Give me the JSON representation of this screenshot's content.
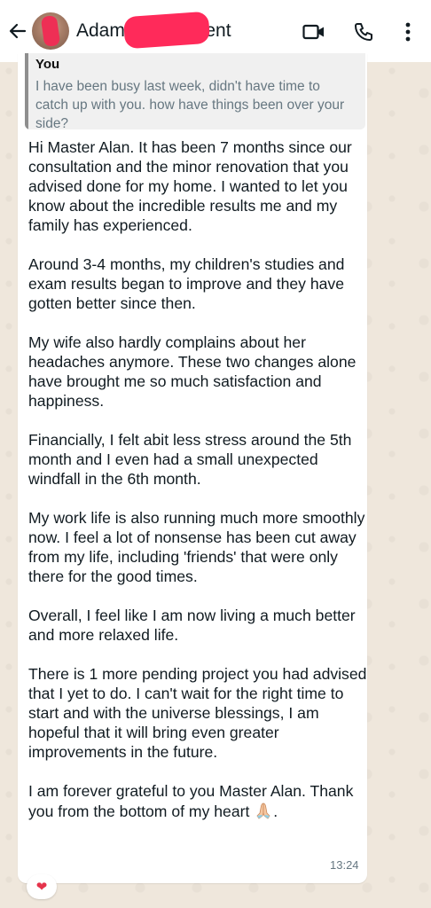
{
  "header": {
    "contact_name_prefix": "Adam",
    "contact_name_suffix": "Client",
    "back_icon": "arrow-left-icon",
    "video_icon": "video-call-icon",
    "call_icon": "phone-icon",
    "menu_icon": "more-vert-icon"
  },
  "quote": {
    "author": "You",
    "text": "I have been busy last week, didn't have time to catch up with you. how have things been over your side?"
  },
  "message": {
    "paragraphs": [
      "Hi Master Alan. It has been 7 months since our consultation and the minor renovation that you advised done for my home. I wanted to let you know about the incredible results me and my family has experienced.",
      "Around 3-4 months, my children's studies and exam results began to improve and they have gotten better since then.",
      "My wife also hardly complains about her headaches anymore. These two changes alone have brought me so much satisfaction and happiness.",
      "Financially, I felt abit less stress around the 5th month and I even had a small unexpected windfall in the 6th month.",
      "My work life is also running much more smoothly now. I feel a lot of nonsense has been cut away from my life, including 'friends' that were only there for the good times.",
      "Overall, I feel like I am now living a much better and more relaxed life.",
      "There is 1 more pending project you had advised that I yet to do. I can't wait for the right time to start and with the universe blessings, I am hopeful that it will bring even greater improvements in the future.",
      "I am forever grateful to you Master Alan. Thank you from the bottom of my heart"
    ],
    "closing_emoji": "folded-hands-icon",
    "closing_punct": ".",
    "time": "13:24",
    "reaction": "❤"
  },
  "colors": {
    "header_bg": "#ffffff",
    "chat_bg": "#efe7dc",
    "bubble_bg": "#ffffff",
    "quote_bg": "#f0f0f0",
    "redaction": "#ff2a5a",
    "reaction": "#e5334b"
  }
}
